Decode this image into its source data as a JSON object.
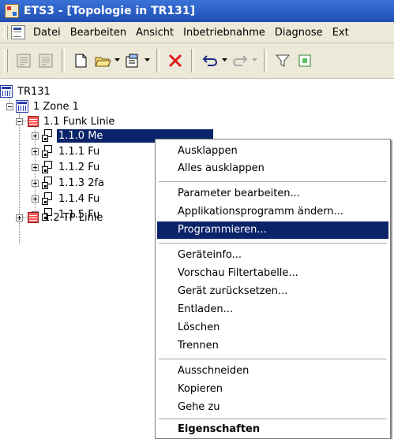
{
  "window": {
    "title": "ETS3 - [Topologie in TR131]"
  },
  "menubar": {
    "items": [
      {
        "label": "Datei",
        "name": "menu-datei"
      },
      {
        "label": "Bearbeiten",
        "name": "menu-bearbeiten"
      },
      {
        "label": "Ansicht",
        "name": "menu-ansicht"
      },
      {
        "label": "Inbetriebnahme",
        "name": "menu-inbetriebnahme"
      },
      {
        "label": "Diagnose",
        "name": "menu-diagnose"
      },
      {
        "label": "Ext",
        "name": "menu-extras"
      }
    ]
  },
  "tree": {
    "root": "TR131",
    "zone": "1 Zone 1",
    "line1": "1.1 Funk Linie",
    "devices": [
      "1.1.0 Me",
      "1.1.1 Fu",
      "1.1.2 Fu",
      "1.1.3 2fa",
      "1.1.4 Fu",
      "1.1.5 Fu"
    ],
    "line2": "1.2 TP Linie"
  },
  "context_menu": {
    "items": [
      "Ausklappen",
      "Alles ausklappen",
      "Parameter bearbeiten...",
      "Applikationsprogramm ändern...",
      "Programmieren...",
      "Geräteinfo...",
      "Vorschau Filtertabelle...",
      "Gerät zurücksetzen...",
      "Entladen...",
      "Löschen",
      "Trennen",
      "Ausschneiden",
      "Kopieren",
      "Gehe zu",
      "Eigenschaften"
    ],
    "highlighted": "Programmieren..."
  },
  "colors": {
    "selection": "#0a246a",
    "titlebar": "#2a5fcb",
    "chrome": "#ece9d8"
  }
}
